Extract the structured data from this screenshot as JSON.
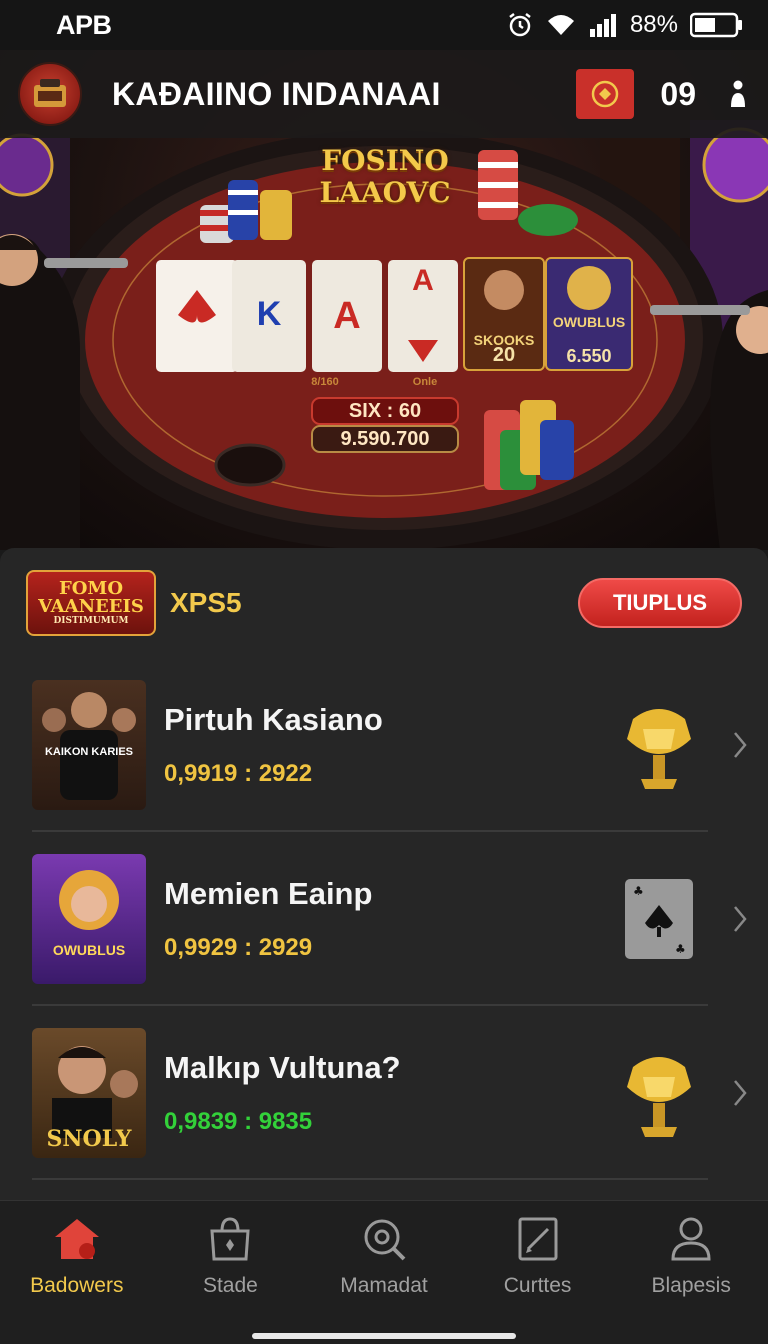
{
  "status_bar": {
    "carrier": "APB",
    "battery": "88%",
    "icons": [
      "alarm-icon",
      "wifi-icon",
      "signal-icon",
      "battery-icon"
    ]
  },
  "header": {
    "title": "KAƉAIINO INDANAAI",
    "count": "09",
    "icons": [
      "casino-logo-icon",
      "promo-badge-icon",
      "user-icon"
    ]
  },
  "hero": {
    "brand": "FOSINO LAAOVC",
    "card_values": [
      "20",
      "6.550"
    ],
    "card_names": [
      "SKOOKS",
      "OWUBLUS"
    ],
    "table_marks": [
      "8/160",
      "Onle"
    ],
    "bet_line": "SIX : 60",
    "pot_line": "9.590.700"
  },
  "section": {
    "logo_text": [
      "FOMO",
      "VAANEEIS",
      "DISTIMUMUM"
    ],
    "title": "XPS5",
    "button_label": "TIUPLUS"
  },
  "games": [
    {
      "title": "Pirtuh Kasiano",
      "stats": "0,9919  :  2922",
      "stats_color": "#f0c441",
      "icon": "gold-trophy-icon",
      "thumb_caption": "KAIKON KARIES"
    },
    {
      "title": "Memien Eainp",
      "stats": "0,9929  :  2929",
      "stats_color": "#f0c441",
      "icon": "spade-card-icon",
      "thumb_caption": "OWUBLUS"
    },
    {
      "title": "Malkıp Vultuna?",
      "stats": "0,9839  :  9835",
      "stats_color": "#33d13a",
      "icon": "gold-trophy-icon",
      "thumb_caption": "SNOLY"
    }
  ],
  "bottom_nav": [
    {
      "label": "Badowers",
      "icon": "home-icon",
      "active": true
    },
    {
      "label": "Stade",
      "icon": "bag-icon",
      "active": false
    },
    {
      "label": "Mamadat",
      "icon": "search-icon",
      "active": false
    },
    {
      "label": "Curttes",
      "icon": "edit-icon",
      "active": false
    },
    {
      "label": "Blapesis",
      "icon": "profile-icon",
      "active": false
    }
  ],
  "colors": {
    "accent_gold": "#f2c94c",
    "accent_red": "#d3302b",
    "background": "#262626"
  }
}
